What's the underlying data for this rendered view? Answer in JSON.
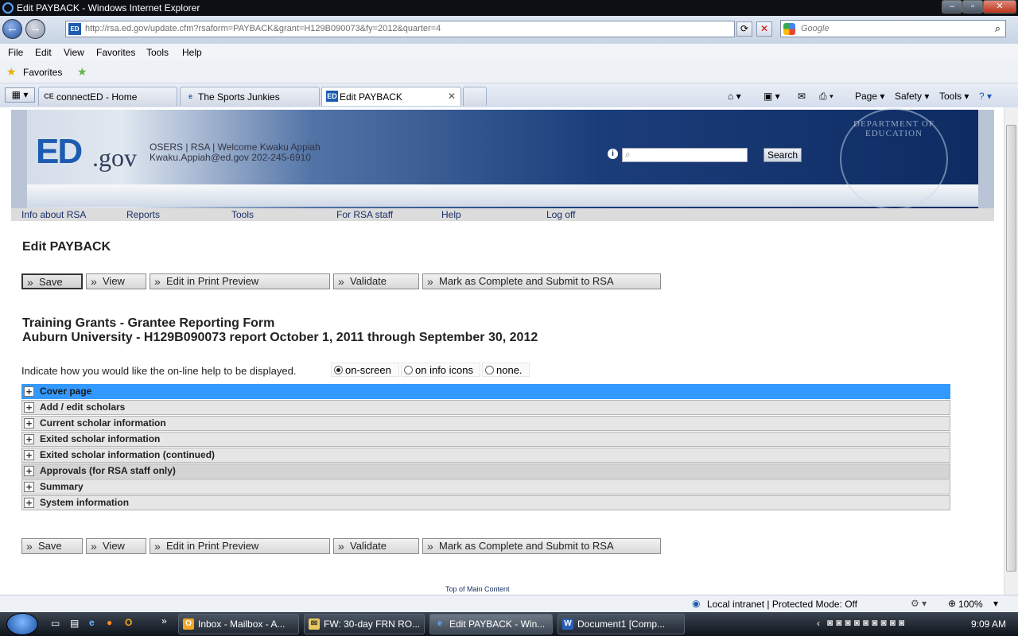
{
  "window": {
    "title": "Edit PAYBACK - Windows Internet Explorer"
  },
  "address": {
    "url": "http://rsa.ed.gov/update.cfm?rsaform=PAYBACK&grant=H129B090073&fy=2012&quarter=4"
  },
  "search_box": {
    "placeholder": "Google"
  },
  "menu": [
    "File",
    "Edit",
    "View",
    "Favorites",
    "Tools",
    "Help"
  ],
  "favorites": {
    "label": "Favorites"
  },
  "tabs": [
    {
      "label": "connectED - Home"
    },
    {
      "label": "The Sports Junkies"
    },
    {
      "label": "Edit PAYBACK"
    }
  ],
  "command_bar": {
    "page": "Page",
    "safety": "Safety",
    "tools": "Tools"
  },
  "site": {
    "header_links": "OSERS | RSA | Welcome Kwaku Appiah",
    "user_contact": "Kwaku.Appiah@ed.gov 202-245-6910",
    "search_button": "Search",
    "seal_text": "DEPARTMENT OF EDUCATION",
    "logo_ed": "ED",
    "logo_gov": ".gov"
  },
  "nav": [
    "Info about RSA",
    "Reports",
    "Tools",
    "For RSA staff",
    "Help",
    "Log off"
  ],
  "page": {
    "title": "Edit PAYBACK",
    "form_title": "Training Grants - Grantee Reporting Form",
    "form_subtitle": "Auburn University - H129B090073 report October 1, 2011 through September 30, 2012",
    "help_prompt": "Indicate how you would like the on-line help to be displayed.",
    "help_options": [
      "on-screen",
      "on info icons",
      "none."
    ],
    "help_selected": "on-screen",
    "top_link": "Top of Main Content"
  },
  "actions": {
    "save": "Save",
    "view": "View",
    "print_preview": "Edit in Print Preview",
    "validate": "Validate",
    "submit": "Mark as Complete and Submit to RSA"
  },
  "sections": [
    "Cover page",
    "Add / edit scholars",
    "Current scholar information",
    "Exited scholar information",
    "Exited scholar information (continued)",
    "Approvals (for RSA staff only)",
    "Summary",
    "System information"
  ],
  "status": {
    "zone": "Local intranet | Protected Mode: Off",
    "zoom": "100%"
  },
  "taskbar": {
    "items": [
      "Inbox - Mailbox - A...",
      "FW: 30-day FRN RO...",
      "Edit PAYBACK - Win...",
      "Document1 [Comp..."
    ],
    "clock": "9:09 AM"
  }
}
